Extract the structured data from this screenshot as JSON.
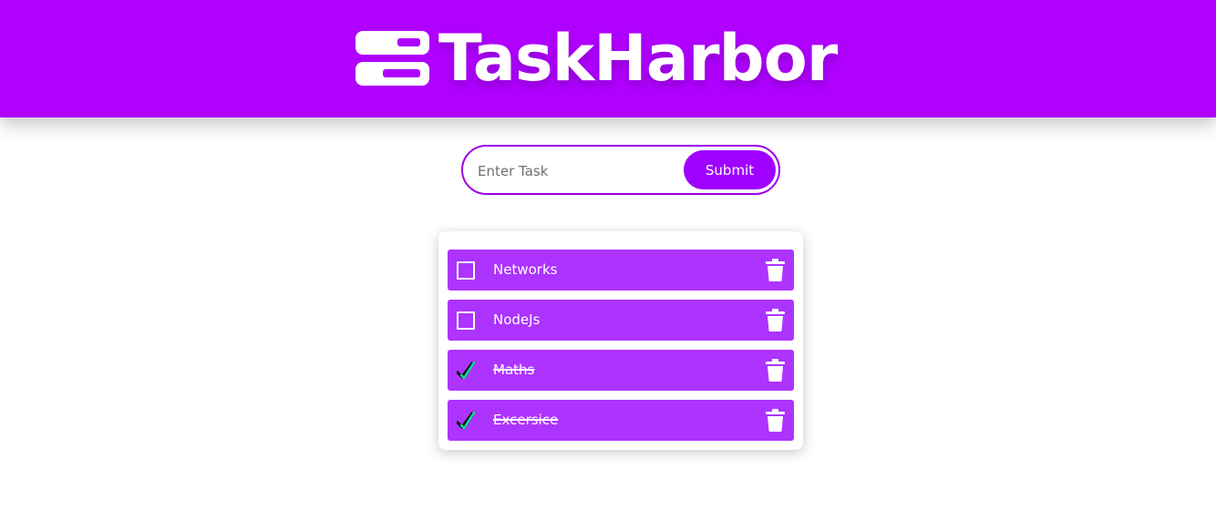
{
  "app": {
    "title": "TaskHarbor",
    "logo_icon": "stacked-bars-logo-icon",
    "colors": {
      "brand": "#b000ff",
      "item_bg": "#ad33ff",
      "check_green": "#00e38a"
    }
  },
  "form": {
    "placeholder": "Enter Task",
    "value": "",
    "submit_label": "Submit"
  },
  "tasks": [
    {
      "text": "Networks",
      "done": false
    },
    {
      "text": "NodeJs",
      "done": false
    },
    {
      "text": "Maths",
      "done": true
    },
    {
      "text": "Excersice",
      "done": true
    }
  ],
  "icons": {
    "unchecked": "square-outline-icon",
    "checked": "checkmark-icon",
    "delete": "trash-icon"
  }
}
